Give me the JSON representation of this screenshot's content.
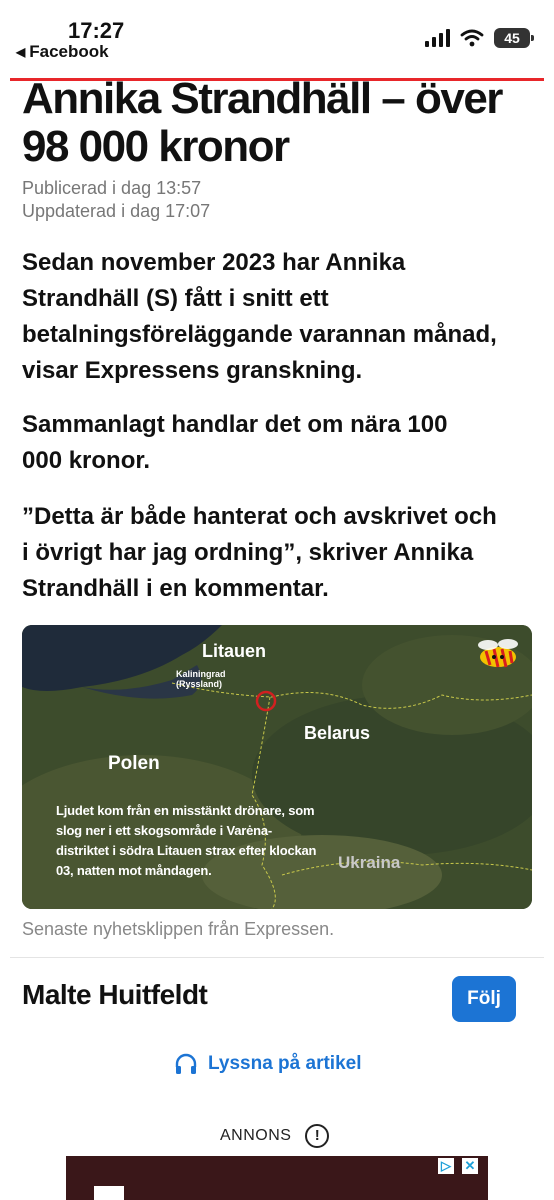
{
  "status_bar": {
    "time": "17:27",
    "back_app": "Facebook",
    "battery": "45"
  },
  "article": {
    "headline_partial": "Annika Strandhäll – över",
    "headline_line2": "98 000 kronor",
    "published": "Publicerad i dag 13:57",
    "updated": "Uppdaterad i dag 17:07",
    "paragraphs": [
      "Sedan november 2023 har Annika Strandhäll (S) fått i snitt ett betalningsföreläggande varannan månad, visar Expressens granskning.",
      "Sammanlagt handlar det om nära 100 000 kronor.",
      "”Detta är både hanterat och avskrivet och i övrigt har jag ordning”, skriver Annika Strandhäll i en kommentar."
    ]
  },
  "video": {
    "map_labels": {
      "litauen": "Litauen",
      "kaliningrad": "Kaliningrad",
      "ryssland": "(Ryssland)",
      "belarus": "Belarus",
      "polen": "Polen",
      "ukraina": "Ukraina"
    },
    "overlay_text_lines": [
      "Ljudet kom från en misstänkt drönare, som",
      "slog ner i ett skogsområde i Varėna-",
      "distriktet i södra Litauen strax efter klockan",
      "03, natten mot måndagen."
    ],
    "caption": "Senaste nyhetsklippen från Expressen."
  },
  "author": {
    "name": "Malte Huitfeldt",
    "follow_label": "Följ"
  },
  "listen_label": "Lyssna på artikel",
  "ad": {
    "label": "ANNONS",
    "info_glyph": "!",
    "choice_glyph": "▷",
    "close_glyph": "✕"
  },
  "colors": {
    "accent_red": "#e8262a",
    "link_blue": "#1c74d4"
  }
}
